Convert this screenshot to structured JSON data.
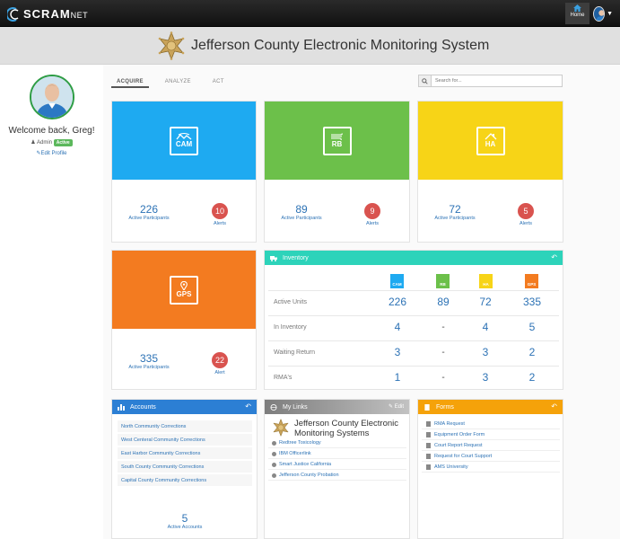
{
  "brand": {
    "name": "SCRAM",
    "suffix": "NET"
  },
  "nav": {
    "home_label": "Home"
  },
  "header": {
    "title": "Jefferson County Electronic Monitoring System"
  },
  "profile": {
    "welcome": "Welcome back, Greg!",
    "role": "Admin",
    "status_badge": "Active",
    "edit_link": "Edit Profile"
  },
  "tabs": [
    {
      "label": "ACQUIRE",
      "active": true
    },
    {
      "label": "ANALYZE",
      "active": false
    },
    {
      "label": "ACT",
      "active": false
    }
  ],
  "search": {
    "placeholder": "Search for..."
  },
  "tiles": [
    {
      "code": "CAM",
      "color": "#1eaaf1",
      "participants": "226",
      "participants_label": "Active Participants",
      "alerts": "10",
      "alerts_label": "Alerts"
    },
    {
      "code": "RB",
      "color": "#6cc04a",
      "participants": "89",
      "participants_label": "Active Participants",
      "alerts": "9",
      "alerts_label": "Alerts"
    },
    {
      "code": "HA",
      "color": "#f7d417",
      "participants": "72",
      "participants_label": "Active Participants",
      "alerts": "5",
      "alerts_label": "Alerts"
    },
    {
      "code": "GPS",
      "color": "#f37b20",
      "participants": "335",
      "participants_label": "Active Participants",
      "alerts": "22",
      "alerts_label": "Alert"
    }
  ],
  "inventory": {
    "title": "Inventory",
    "header_color": "#2dd3ba",
    "columns": [
      "CAM",
      "RB",
      "HA",
      "GPS"
    ],
    "rows": [
      {
        "label": "Active Units",
        "values": [
          "226",
          "89",
          "72",
          "335"
        ]
      },
      {
        "label": "In Inventory",
        "values": [
          "4",
          "-",
          "4",
          "5"
        ]
      },
      {
        "label": "Waiting Return",
        "values": [
          "3",
          "-",
          "3",
          "2"
        ]
      },
      {
        "label": "RMA's",
        "values": [
          "1",
          "-",
          "3",
          "2"
        ]
      }
    ]
  },
  "accounts": {
    "title": "Accounts",
    "header_color": "#2c7fd4",
    "items": [
      "North Community Corrections",
      "West Centeral Community Corrections",
      "East Harbor Community Corrections",
      "South County Community Corrections",
      "Capital County Community Corrections"
    ],
    "active_count": "5",
    "active_label": "Active Accounts"
  },
  "my_links": {
    "title": "My Links",
    "edit_label": "Edit",
    "header_color": "#9a9a9a",
    "agency_title": "Jefferson County Electronic Monitoring Systems",
    "items": [
      "Redtree Toxicology",
      "IBM Officerlink",
      "Smart Justice California",
      "Jefferson County Probation"
    ]
  },
  "forms": {
    "title": "Forms",
    "header_color": "#f5a20a",
    "items": [
      "RMA Request",
      "Equipment Order Form",
      "Court Report Request",
      "Request for Court Support",
      "AMS University"
    ]
  }
}
